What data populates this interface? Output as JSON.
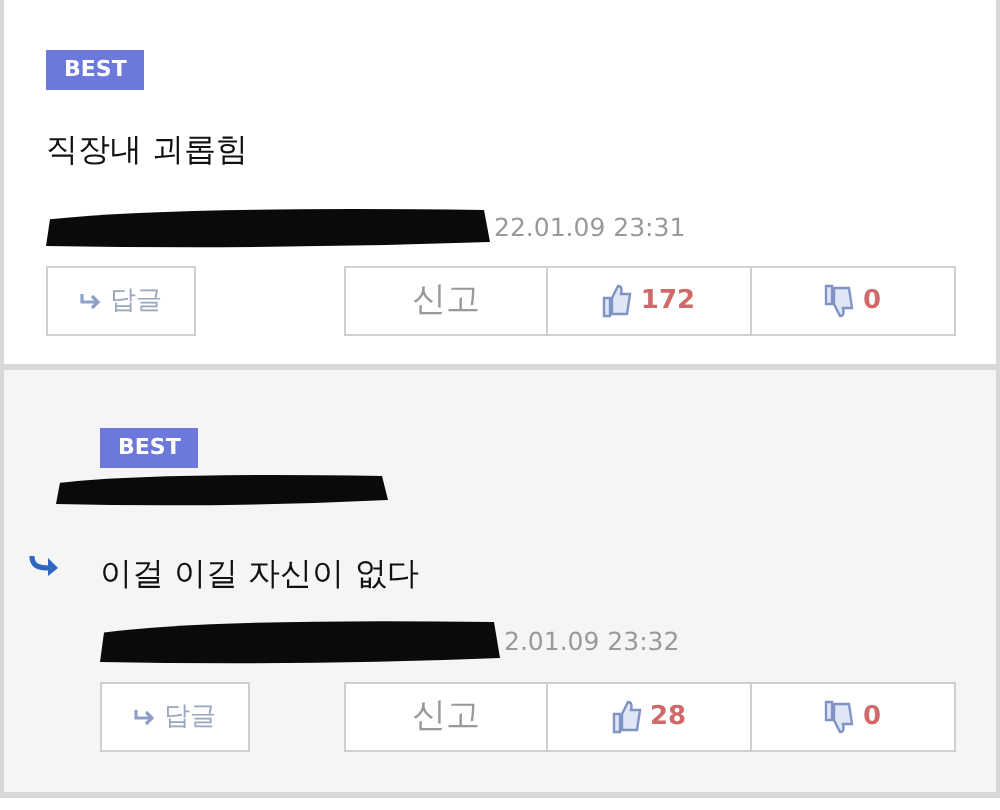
{
  "comments": [
    {
      "kind": "top",
      "badge": "BEST",
      "text": "직장내 괴롭힘",
      "redacted_author": true,
      "date": "22.01.09 23:31",
      "reply_label": "답글",
      "report_label": "신고",
      "likes": "172",
      "dislikes": "0"
    },
    {
      "kind": "reply",
      "badge": "BEST",
      "text": "이걸 이길 자신이 없다",
      "redacted_author": true,
      "date": "2.01.09 23:32",
      "reply_label": "답글",
      "report_label": "신고",
      "likes": "28",
      "dislikes": "0"
    }
  ]
}
